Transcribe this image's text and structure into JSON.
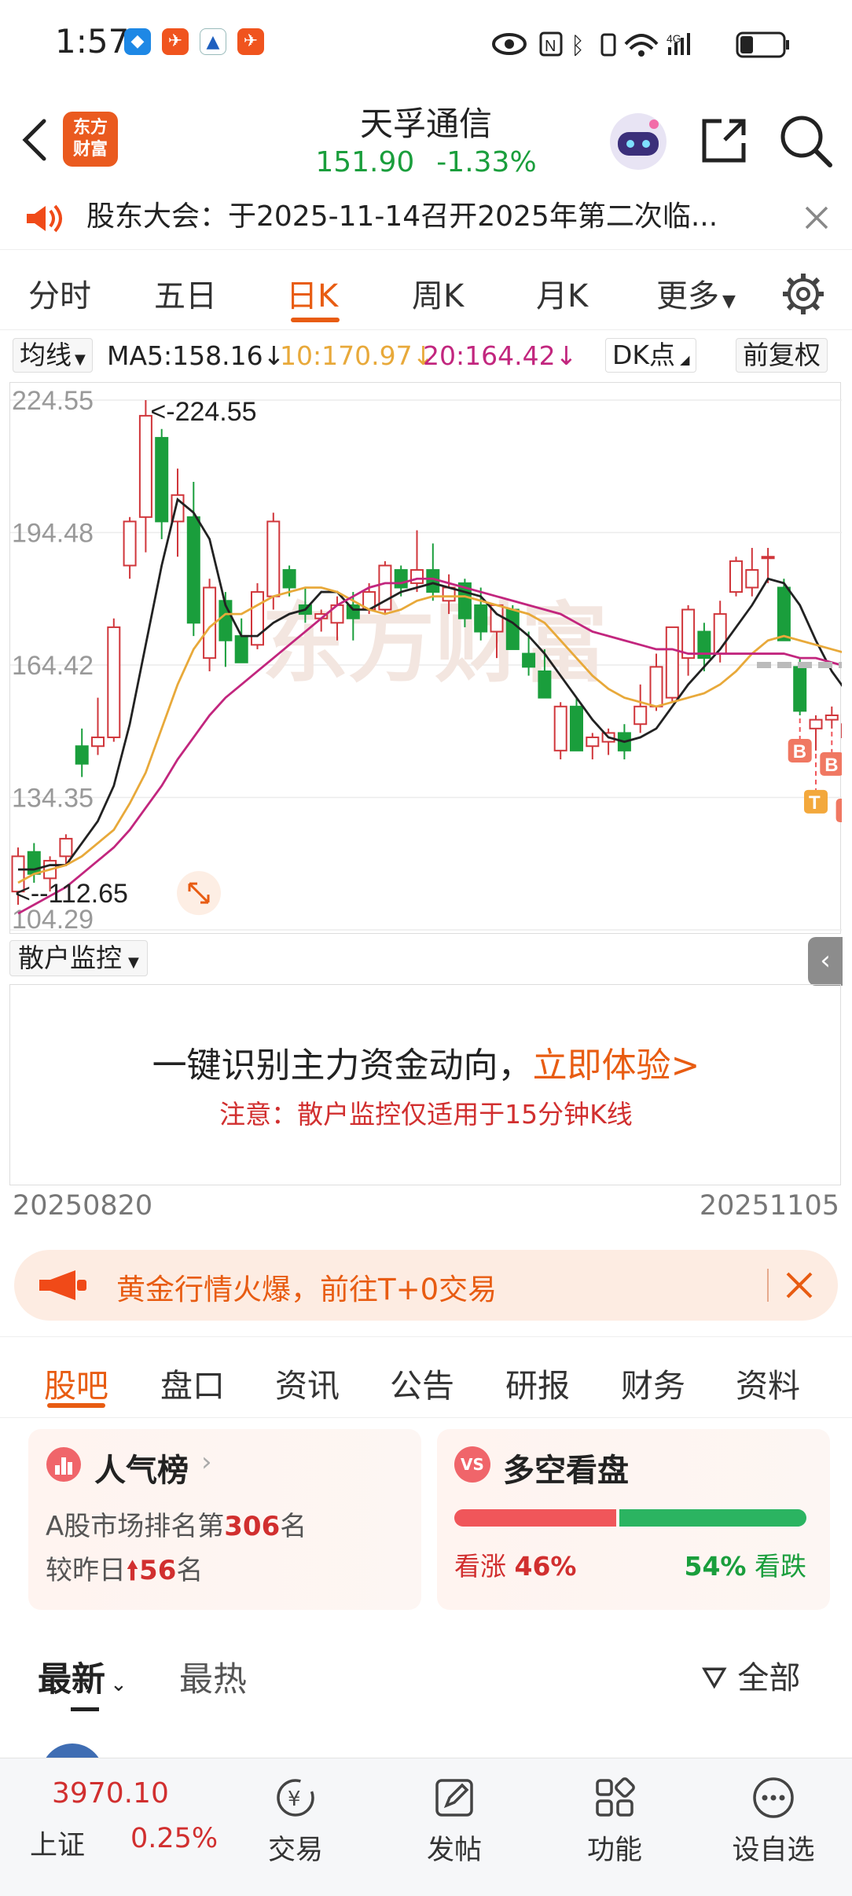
{
  "status_bar": {
    "time": "1:57",
    "network": "4G"
  },
  "header": {
    "logo_text": "东方财富",
    "stock_name": "天孚通信",
    "price": "151.90",
    "change_pct": "-1.33%"
  },
  "notice": {
    "text": "股东大会：于2025-11-14召开2025年第二次临..."
  },
  "chart_tabs": [
    "分时",
    "五日",
    "日K",
    "周K",
    "月K",
    "更多"
  ],
  "active_chart_tab": "日K",
  "indicator_bar": {
    "indicator": "均线",
    "ma5": "MA5:158.16↓",
    "ma10": "10:170.97↓",
    "ma20": "20:164.42↓",
    "dk_label": "DK点",
    "adjust_label": "前复权"
  },
  "chart_data": {
    "type": "candlestick",
    "y_ticks": [
      "224.55",
      "194.48",
      "164.42",
      "134.35",
      "104.29"
    ],
    "ylim": [
      104.29,
      224.55
    ],
    "high_marker": "224.55",
    "low_marker": "112.65",
    "watermark": "东方财富",
    "x_start": "20250820",
    "x_end": "20251105",
    "colors": {
      "up": "#d0363b",
      "down": "#1a9e3c",
      "ma5": "#222222",
      "ma10": "#e8a93a",
      "ma20": "#c2267e"
    },
    "candles": [
      {
        "o": 113,
        "h": 123,
        "l": 110,
        "c": 121
      },
      {
        "o": 122,
        "h": 124,
        "l": 115,
        "c": 117
      },
      {
        "o": 116,
        "h": 121,
        "l": 113,
        "c": 120
      },
      {
        "o": 121,
        "h": 126,
        "l": 119,
        "c": 125
      },
      {
        "o": 146,
        "h": 150,
        "l": 139,
        "c": 142
      },
      {
        "o": 146,
        "h": 157,
        "l": 144,
        "c": 148
      },
      {
        "o": 148,
        "h": 175,
        "l": 147,
        "c": 173
      },
      {
        "o": 187,
        "h": 198,
        "l": 184,
        "c": 197
      },
      {
        "o": 198,
        "h": 224.55,
        "l": 190,
        "c": 221
      },
      {
        "o": 216,
        "h": 218,
        "l": 193,
        "c": 197
      },
      {
        "o": 197,
        "h": 209,
        "l": 189,
        "c": 203
      },
      {
        "o": 198,
        "h": 206,
        "l": 171,
        "c": 174
      },
      {
        "o": 166,
        "h": 184,
        "l": 163,
        "c": 182
      },
      {
        "o": 179,
        "h": 181,
        "l": 164,
        "c": 170
      },
      {
        "o": 171,
        "h": 175,
        "l": 165,
        "c": 165
      },
      {
        "o": 169,
        "h": 183,
        "l": 168,
        "c": 181
      },
      {
        "o": 180,
        "h": 199,
        "l": 177,
        "c": 197
      },
      {
        "o": 186,
        "h": 187,
        "l": 180,
        "c": 182
      },
      {
        "o": 178,
        "h": 182,
        "l": 174,
        "c": 176
      },
      {
        "o": 175,
        "h": 177,
        "l": 172,
        "c": 176
      },
      {
        "o": 174,
        "h": 180,
        "l": 170,
        "c": 178
      },
      {
        "o": 178,
        "h": 181,
        "l": 170,
        "c": 175
      },
      {
        "o": 177,
        "h": 183,
        "l": 176,
        "c": 181
      },
      {
        "o": 177,
        "h": 188,
        "l": 176,
        "c": 187
      },
      {
        "o": 186,
        "h": 187,
        "l": 180,
        "c": 182
      },
      {
        "o": 183,
        "h": 195,
        "l": 181,
        "c": 186
      },
      {
        "o": 186,
        "h": 192,
        "l": 179,
        "c": 181
      },
      {
        "o": 179,
        "h": 185,
        "l": 176,
        "c": 182
      },
      {
        "o": 183,
        "h": 184,
        "l": 173,
        "c": 175
      },
      {
        "o": 178,
        "h": 182,
        "l": 170,
        "c": 172
      },
      {
        "o": 172,
        "h": 178,
        "l": 166,
        "c": 178
      },
      {
        "o": 177,
        "h": 178,
        "l": 168,
        "c": 168
      },
      {
        "o": 167,
        "h": 172,
        "l": 162,
        "c": 164
      },
      {
        "o": 163,
        "h": 168,
        "l": 157,
        "c": 157
      },
      {
        "o": 145,
        "h": 156,
        "l": 143,
        "c": 155
      },
      {
        "o": 155,
        "h": 157,
        "l": 146,
        "c": 145
      },
      {
        "o": 146,
        "h": 149,
        "l": 143,
        "c": 148
      },
      {
        "o": 147,
        "h": 150,
        "l": 144,
        "c": 149
      },
      {
        "o": 149,
        "h": 151,
        "l": 143,
        "c": 145
      },
      {
        "o": 151,
        "h": 160,
        "l": 149,
        "c": 155
      },
      {
        "o": 155,
        "h": 167,
        "l": 154,
        "c": 164
      },
      {
        "o": 157,
        "h": 170,
        "l": 156,
        "c": 173
      },
      {
        "o": 166,
        "h": 178,
        "l": 162,
        "c": 177
      },
      {
        "o": 172,
        "h": 174,
        "l": 163,
        "c": 166
      },
      {
        "o": 167,
        "h": 179,
        "l": 165,
        "c": 176
      },
      {
        "o": 181,
        "h": 189,
        "l": 180,
        "c": 188
      },
      {
        "o": 182,
        "h": 191,
        "l": 180,
        "c": 186
      },
      {
        "o": 189,
        "h": 191,
        "l": 183,
        "c": 189
      },
      {
        "o": 182,
        "h": 184,
        "l": 170,
        "c": 170
      },
      {
        "o": 164,
        "h": 166,
        "l": 153,
        "c": 154
      },
      {
        "o": 150,
        "h": 153,
        "l": 145,
        "c": 152
      },
      {
        "o": 152,
        "h": 155,
        "l": 150,
        "c": 153
      },
      {
        "o": 148,
        "h": 152,
        "l": 143,
        "c": 151
      }
    ],
    "ma5": [
      118,
      118,
      119,
      119,
      124,
      129,
      137,
      151,
      169,
      187,
      202,
      199,
      193,
      178,
      171,
      171,
      174,
      176,
      177,
      181,
      181,
      177,
      177,
      179,
      181,
      182,
      183,
      182,
      181,
      180,
      176,
      174,
      171,
      167,
      162,
      157,
      152,
      148,
      147,
      148,
      150,
      155,
      160,
      164,
      168,
      173,
      178,
      184,
      183,
      178,
      170,
      163,
      158
    ],
    "ma10": [
      115,
      117,
      118,
      119,
      121,
      124,
      127,
      133,
      140,
      150,
      160,
      168,
      173,
      176,
      176,
      178,
      180,
      181,
      182,
      182,
      181,
      179,
      177,
      176,
      177,
      179,
      180,
      180,
      180,
      179,
      178,
      177,
      176,
      174,
      170,
      166,
      162,
      159,
      157,
      156,
      155,
      156,
      157,
      158,
      160,
      163,
      167,
      170,
      171,
      170,
      169,
      168,
      167
    ],
    "ma20": [
      108,
      110,
      112,
      114,
      117,
      120,
      123,
      127,
      132,
      137,
      143,
      148,
      153,
      157,
      160,
      163,
      166,
      169,
      172,
      175,
      178,
      180,
      182,
      183,
      183,
      184,
      184,
      183,
      182,
      181,
      180,
      179,
      178,
      177,
      176,
      174,
      172,
      171,
      170,
      169,
      168,
      168,
      167,
      167,
      167,
      167,
      167,
      167,
      167,
      166,
      166,
      165,
      164
    ],
    "trade_marks": [
      {
        "i": 49,
        "label": "B"
      },
      {
        "i": 50,
        "label": "T"
      },
      {
        "i": 51,
        "label": "B"
      },
      {
        "i": 52,
        "label": "B"
      }
    ]
  },
  "retail_monitor": {
    "selector": "散户监控",
    "headline": "一键识别主力资金动向，",
    "cta": "立即体验>",
    "note": "注意：散户监控仅适用于15分钟K线"
  },
  "date_range": {
    "start": "20250820",
    "end": "20251105"
  },
  "promo": {
    "text": "黄金行情火爆，前往T+0交易"
  },
  "section_tabs": [
    "股吧",
    "盘口",
    "资讯",
    "公告",
    "研报",
    "财务",
    "资料"
  ],
  "active_section": "股吧",
  "popularity": {
    "title": "人气榜",
    "line1_prefix": "A股市场排名第",
    "rank": "306",
    "line1_suffix": "名",
    "line2_prefix": "较昨日",
    "change": "56",
    "line2_suffix": "名"
  },
  "sentiment": {
    "title": "多空看盘",
    "bull_label": "看涨",
    "bull_pct": "46%",
    "bear_pct": "54%",
    "bear_label": "看跌",
    "bull_value": 0.46
  },
  "feed_tabs": {
    "latest": "最新",
    "hot": "最热",
    "filter": "全部"
  },
  "bottom_bar": {
    "index_value": "3970.10",
    "index_name": "上证",
    "index_change": "0.25%",
    "items": [
      "交易",
      "发帖",
      "功能",
      "设自选"
    ]
  }
}
